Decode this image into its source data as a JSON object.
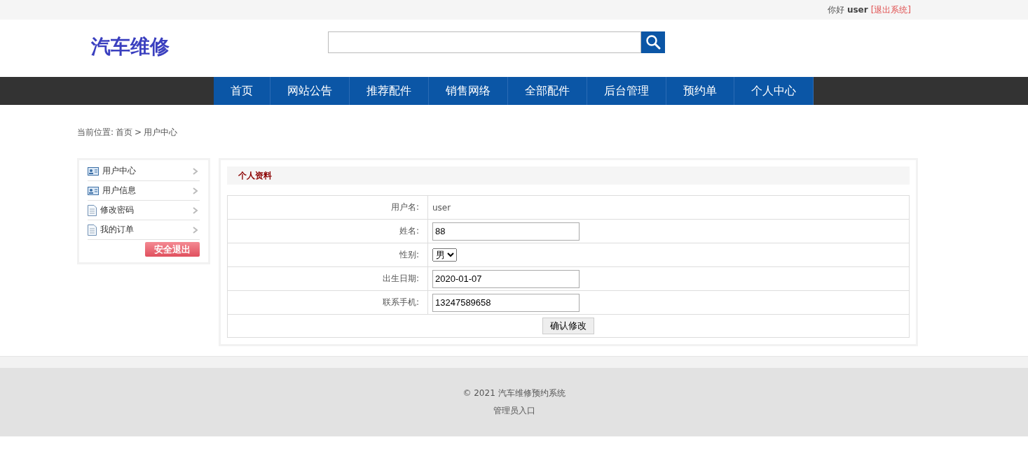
{
  "top_bar": {
    "greeting": "你好",
    "username": "user",
    "logout_link": "[退出系统]"
  },
  "header": {
    "logo": "汽车维修"
  },
  "nav": [
    {
      "label": "首页"
    },
    {
      "label": "网站公告"
    },
    {
      "label": "推荐配件"
    },
    {
      "label": "销售网络"
    },
    {
      "label": "全部配件"
    },
    {
      "label": "后台管理"
    },
    {
      "label": "预约单"
    },
    {
      "label": "个人中心"
    }
  ],
  "breadcrumb": {
    "prefix": "当前位置:",
    "home": "首页",
    "separator": ">",
    "current": "用户中心"
  },
  "sidebar": {
    "items": [
      {
        "label": "用户中心",
        "kind": "card"
      },
      {
        "label": "用户信息",
        "kind": "card"
      },
      {
        "label": "修改密码",
        "kind": "doc"
      },
      {
        "label": "我的订单",
        "kind": "doc"
      }
    ],
    "logout_button": "安全退出"
  },
  "profile": {
    "title": "个人资料",
    "rows": [
      {
        "label": "用户名:",
        "kind": "text",
        "value": "user"
      },
      {
        "label": "姓名:",
        "kind": "input",
        "value": "88"
      },
      {
        "label": "性别:",
        "kind": "select",
        "value": "男"
      },
      {
        "label": "出生日期:",
        "kind": "input",
        "value": "2020-01-07"
      },
      {
        "label": "联系手机:",
        "kind": "input",
        "value": "13247589658"
      }
    ],
    "submit": "确认修改"
  },
  "footer": {
    "copyright": "© 2021 汽车维修预约系统",
    "admin_link": "管理员入口"
  }
}
